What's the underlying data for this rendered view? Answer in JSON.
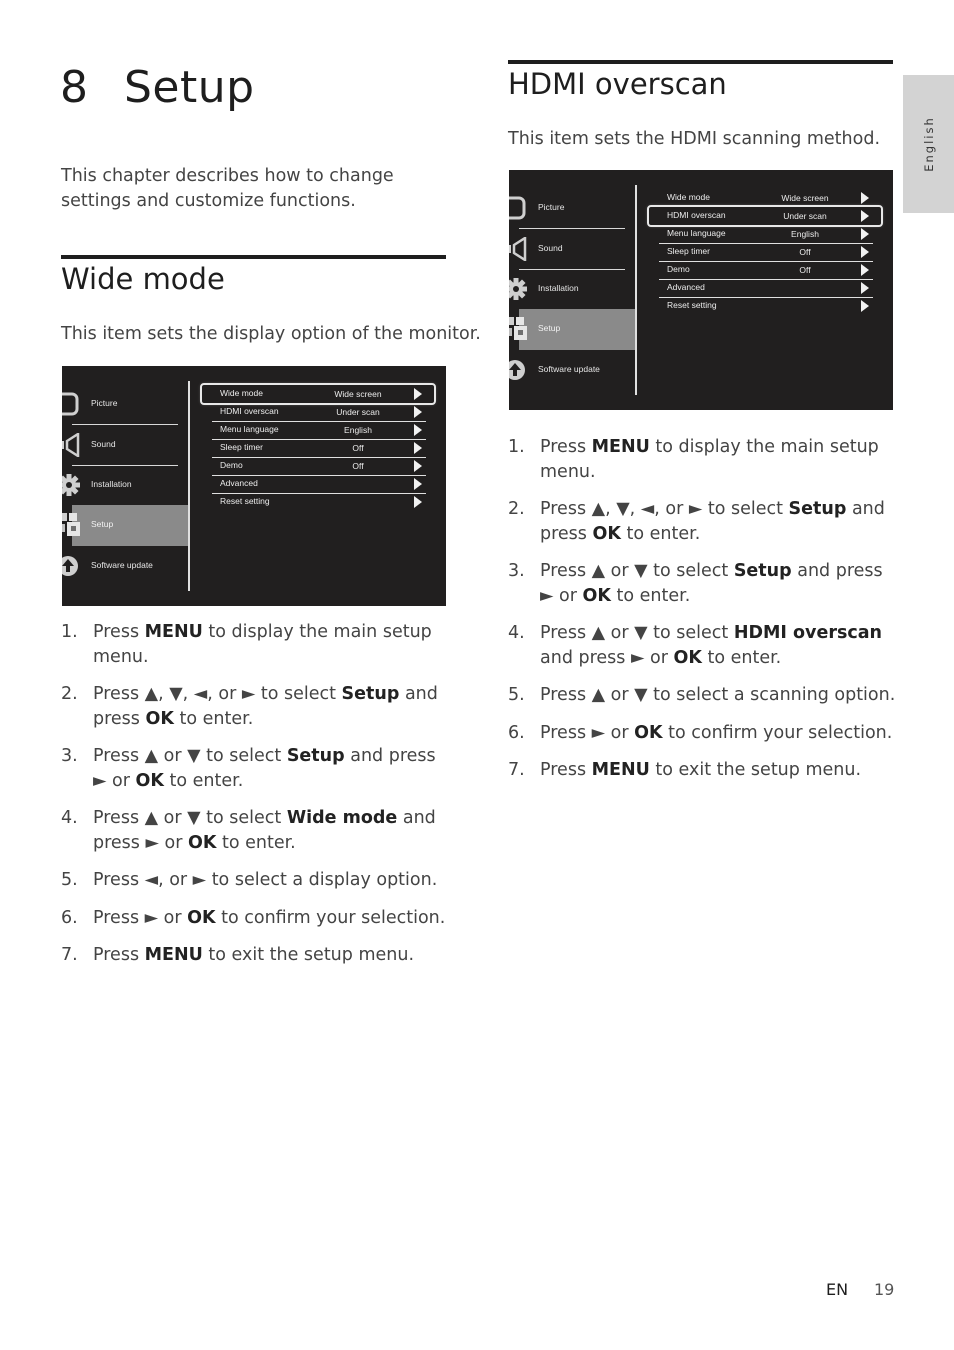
{
  "chapter": {
    "number": "8",
    "title": "Setup",
    "intro": "This chapter describes how to change settings and customize functions."
  },
  "language_tab": "English",
  "osd_menu": {
    "left_items": [
      {
        "label": "Picture",
        "icon": "picture-icon"
      },
      {
        "label": "Sound",
        "icon": "speaker-icon"
      },
      {
        "label": "Installation",
        "icon": "gear-icon"
      },
      {
        "label": "Setup",
        "icon": "setup-icon",
        "active": true
      },
      {
        "label": "Software update",
        "icon": "update-icon"
      }
    ],
    "right_items": [
      {
        "name": "Wide mode",
        "value": "Wide screen"
      },
      {
        "name": "HDMI overscan",
        "value": "Under scan"
      },
      {
        "name": "Menu language",
        "value": "English"
      },
      {
        "name": "Sleep timer",
        "value": "Off"
      },
      {
        "name": "Demo",
        "value": "Off"
      },
      {
        "name": "Advanced",
        "value": ""
      },
      {
        "name": "Reset setting",
        "value": ""
      }
    ]
  },
  "sections": [
    {
      "title": "Wide mode",
      "description": "This item sets the display option of the monitor.",
      "selected_row": "Wide mode",
      "steps": [
        {
          "num": "1.",
          "parts": [
            "Press ",
            "*MENU",
            " to display the main setup menu."
          ]
        },
        {
          "num": "2.",
          "parts": [
            "Press ▲, ▼, ◄, or ► to select ",
            "*Setup",
            " and press ",
            "*OK",
            " to enter."
          ]
        },
        {
          "num": "3.",
          "parts": [
            "Press ▲ or ▼ to select ",
            "*Setup",
            " and press ► or ",
            "*OK",
            " to enter."
          ]
        },
        {
          "num": "4.",
          "parts": [
            "Press ▲ or ▼ to select ",
            "*Wide mode",
            " and press ► or ",
            "*OK",
            " to enter."
          ]
        },
        {
          "num": "5.",
          "parts": [
            "Press ◄, or ► to select a display option."
          ]
        },
        {
          "num": "6.",
          "parts": [
            "Press ► or ",
            "*OK",
            " to confirm your selection."
          ]
        },
        {
          "num": "7.",
          "parts": [
            "Press ",
            "*MENU",
            " to exit the setup menu."
          ]
        }
      ]
    },
    {
      "title": "HDMI overscan",
      "description": "This item sets the HDMI scanning method.",
      "selected_row": "HDMI overscan",
      "steps": [
        {
          "num": "1.",
          "parts": [
            "Press ",
            "*MENU",
            " to display the main setup menu."
          ]
        },
        {
          "num": "2.",
          "parts": [
            "Press ▲, ▼, ◄, or ► to select ",
            "*Setup",
            " and press ",
            "*OK",
            " to enter."
          ]
        },
        {
          "num": "3.",
          "parts": [
            "Press ▲ or ▼ to select ",
            "*Setup",
            " and press ► or ",
            "*OK",
            " to enter."
          ]
        },
        {
          "num": "4.",
          "parts": [
            "Press ▲ or ▼ to select ",
            "*HDMI overscan",
            " and press ► or ",
            "*OK",
            " to enter."
          ]
        },
        {
          "num": "5.",
          "parts": [
            "Press ▲ or ▼ to select a scanning option."
          ]
        },
        {
          "num": "6.",
          "parts": [
            "Press ► or ",
            "*OK",
            " to confirm your selection."
          ]
        },
        {
          "num": "7.",
          "parts": [
            "Press ",
            "*MENU",
            " to exit the setup menu."
          ]
        }
      ]
    }
  ],
  "footer": {
    "lang": "EN",
    "page": "19"
  }
}
